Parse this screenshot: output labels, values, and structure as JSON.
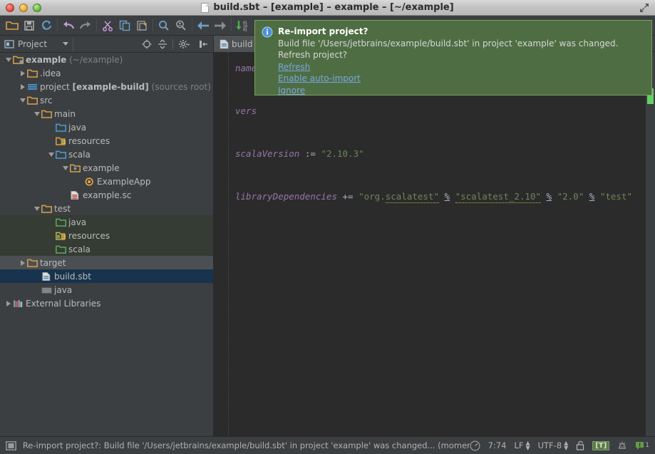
{
  "window": {
    "title": "build.sbt – [example] – example – [~/example]",
    "doc_icon": "document-icon",
    "fullscreen_icon": "fullscreen-icon",
    "traffic_lights": [
      "close-button",
      "minimize-button",
      "zoom-button"
    ]
  },
  "toolbar": {
    "buttons": [
      {
        "name": "open-folder-icon",
        "tip": "Open"
      },
      {
        "name": "save-all-icon",
        "tip": "Save All"
      },
      {
        "name": "sync-refresh-icon",
        "tip": "Synchronize"
      },
      {
        "name": "undo-icon",
        "tip": "Undo"
      },
      {
        "name": "redo-icon",
        "tip": "Redo"
      },
      {
        "name": "cut-icon",
        "tip": "Cut"
      },
      {
        "name": "copy-icon",
        "tip": "Copy"
      },
      {
        "name": "paste-icon",
        "tip": "Paste"
      },
      {
        "name": "find-icon",
        "tip": "Find"
      },
      {
        "name": "find-replace-icon",
        "tip": "Replace"
      },
      {
        "name": "back-arrow-icon",
        "tip": "Back"
      },
      {
        "name": "forward-arrow-icon",
        "tip": "Forward"
      },
      {
        "name": "update-project-icon",
        "tip": "Update Project"
      }
    ]
  },
  "project_panel": {
    "title": "Project",
    "title_icon": "project-view-icon",
    "dropdown_icon": "chevron-down-icon",
    "tools": [
      {
        "name": "scroll-to-source-icon"
      },
      {
        "name": "collapse-all-icon"
      },
      {
        "name": "settings-gear-icon"
      },
      {
        "name": "hide-panel-icon"
      }
    ],
    "tree": [
      {
        "indent": 0,
        "arrow": "down",
        "icon": "module-folder-icon",
        "label": "example",
        "bold": true,
        "suffix": "(~/example)",
        "row_style": "none"
      },
      {
        "indent": 1,
        "arrow": "right",
        "icon": "folder-icon",
        "label": ".idea",
        "bold": false,
        "suffix": "",
        "row_style": "none"
      },
      {
        "indent": 1,
        "arrow": "right",
        "icon": "module-group-icon",
        "label": "project",
        "bold": false,
        "label_bold": "[example-build]",
        "suffix": "(sources root)",
        "row_style": "none"
      },
      {
        "indent": 1,
        "arrow": "down",
        "icon": "folder-icon",
        "label": "src",
        "bold": false,
        "suffix": "",
        "row_style": "none"
      },
      {
        "indent": 2,
        "arrow": "down",
        "icon": "folder-icon",
        "label": "main",
        "bold": false,
        "suffix": "",
        "row_style": "none"
      },
      {
        "indent": 3,
        "arrow": "none",
        "icon": "source-folder-icon",
        "label": "java",
        "bold": false,
        "suffix": "",
        "row_style": "none"
      },
      {
        "indent": 3,
        "arrow": "none",
        "icon": "resource-folder-icon",
        "label": "resources",
        "bold": false,
        "suffix": "",
        "row_style": "none"
      },
      {
        "indent": 3,
        "arrow": "down",
        "icon": "source-folder-icon",
        "label": "scala",
        "bold": false,
        "suffix": "",
        "row_style": "none"
      },
      {
        "indent": 4,
        "arrow": "down",
        "icon": "package-folder-icon",
        "label": "example",
        "bold": false,
        "suffix": "",
        "row_style": "none"
      },
      {
        "indent": 5,
        "arrow": "none",
        "icon": "scala-object-icon",
        "label": "ExampleApp",
        "bold": false,
        "suffix": "",
        "row_style": "none"
      },
      {
        "indent": 4,
        "arrow": "none",
        "icon": "scala-script-icon",
        "label": "example.sc",
        "bold": false,
        "suffix": "",
        "row_style": "none"
      },
      {
        "indent": 2,
        "arrow": "down",
        "icon": "folder-icon",
        "label": "test",
        "bold": false,
        "suffix": "",
        "row_style": "none"
      },
      {
        "indent": 3,
        "arrow": "none",
        "icon": "test-source-folder-icon",
        "label": "java",
        "bold": false,
        "suffix": "",
        "row_style": "test"
      },
      {
        "indent": 3,
        "arrow": "none",
        "icon": "test-resource-folder-icon",
        "label": "resources",
        "bold": false,
        "suffix": "",
        "row_style": "test"
      },
      {
        "indent": 3,
        "arrow": "none",
        "icon": "test-source-folder-icon",
        "label": "scala",
        "bold": false,
        "suffix": "",
        "row_style": "test"
      },
      {
        "indent": 1,
        "arrow": "right",
        "icon": "folder-icon",
        "label": "target",
        "bold": false,
        "suffix": "",
        "row_style": "target"
      },
      {
        "indent": 2,
        "arrow": "none",
        "icon": "sbt-file-icon",
        "label": "build.sbt",
        "bold": false,
        "suffix": "",
        "row_style": "selected"
      },
      {
        "indent": 2,
        "arrow": "none",
        "icon": "excluded-folder-icon",
        "label": "java",
        "bold": false,
        "suffix": "",
        "row_style": "none"
      },
      {
        "indent": 0,
        "arrow": "right",
        "icon": "libraries-icon",
        "label": "External Libraries",
        "bold": false,
        "suffix": "",
        "row_style": "none"
      }
    ]
  },
  "editor": {
    "tab": {
      "label": "build",
      "icon": "sbt-file-icon"
    },
    "lines": [
      {
        "segments": [
          {
            "t": "name",
            "c": "kw"
          }
        ]
      },
      {
        "segments": []
      },
      {
        "segments": [
          {
            "t": "vers",
            "c": "kw"
          }
        ]
      },
      {
        "segments": []
      },
      {
        "segments": [
          {
            "t": "scalaVersion ",
            "c": "kw"
          },
          {
            "t": ":= ",
            "c": "op"
          },
          {
            "t": "\"2.10.3\"",
            "c": "str"
          }
        ]
      },
      {
        "segments": []
      },
      {
        "segments": [
          {
            "t": "libraryDependencies ",
            "c": "kw"
          },
          {
            "t": "+= ",
            "c": "op"
          },
          {
            "t": "\"org.",
            "c": "str"
          },
          {
            "t": "scalatest\"",
            "c": "str sq"
          },
          {
            "t": " ",
            "c": "op"
          },
          {
            "t": "%",
            "c": "op ul"
          },
          {
            "t": " ",
            "c": "op"
          },
          {
            "t": "\"scalatest_2.10\"",
            "c": "str sq"
          },
          {
            "t": " ",
            "c": "op"
          },
          {
            "t": "%",
            "c": "op ul"
          },
          {
            "t": " ",
            "c": "op"
          },
          {
            "t": "\"2.0\"",
            "c": "str"
          },
          {
            "t": " ",
            "c": "op"
          },
          {
            "t": "%",
            "c": "op ul"
          },
          {
            "t": " ",
            "c": "op"
          },
          {
            "t": "\"test\"",
            "c": "str"
          }
        ]
      }
    ]
  },
  "notification": {
    "icon": "info-icon",
    "title": "Re-import project?",
    "message_line1": "Build file '/Users/jetbrains/example/build.sbt' in project 'example' was changed.",
    "message_line2": "Refresh project?",
    "links": [
      "Refresh ",
      "Enable auto-import",
      "Ignore"
    ]
  },
  "statusbar": {
    "left_icon": "toggle-toolbars-icon",
    "message": "Re-import project?:  Build file '/Users/jetbrains/example/build.sbt' in project 'example' was changed... (moments ago)",
    "clock_icon": "background-tasks-icon",
    "caret_position": "7:74",
    "line_separator": "LF",
    "encoding": "UTF-8",
    "lock_icon": "unlocked-icon",
    "transparency_badge": "[T]",
    "hector_icon": "hector-inspector-icon",
    "error_count": "1",
    "error_icon": "error-notification-icon"
  },
  "colors": {
    "popup_bg": "#4f6d43",
    "popup_border": "#7aa05e",
    "link": "#7aa7e0",
    "selection": "#17334d",
    "test_group": "#343c33",
    "target_row": "#4b4f52",
    "editor_bg": "#2b2b2b",
    "panel_bg": "#3c3f41",
    "string": "#6a8759",
    "keyword": "#9876aa"
  }
}
